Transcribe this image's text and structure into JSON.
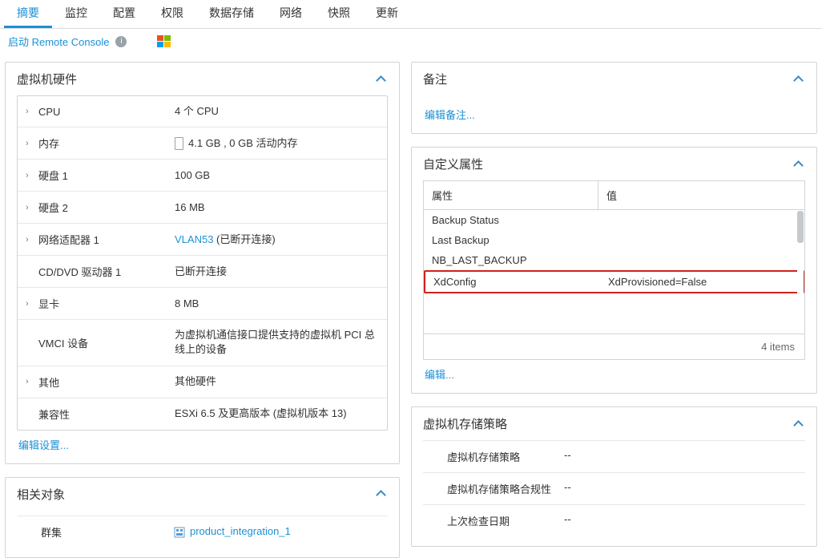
{
  "tabs": [
    "摘要",
    "监控",
    "配置",
    "权限",
    "数据存储",
    "网络",
    "快照",
    "更新"
  ],
  "console_link": "启动 Remote Console",
  "hw": {
    "title": "虚拟机硬件",
    "edit_link": "编辑设置...",
    "rows": {
      "cpu_k": "CPU",
      "cpu_v": "4 个 CPU",
      "mem_k": "内存",
      "mem_v": "4.1 GB , 0 GB 活动内存",
      "d1_k": "硬盘 1",
      "d1_v": "100 GB",
      "d2_k": "硬盘 2",
      "d2_v": "16 MB",
      "net_k": "网络适配器 1",
      "net_v_link": "VLAN53",
      "net_v_suffix": " (已断开连接)",
      "cd_k": "CD/DVD 驱动器 1",
      "cd_v": "已断开连接",
      "vid_k": "显卡",
      "vid_v": "8 MB",
      "vmci_k": "VMCI 设备",
      "vmci_v": "为虚拟机通信接口提供支持的虚拟机 PCI 总线上的设备",
      "oth_k": "其他",
      "oth_v": "其他硬件",
      "comp_k": "兼容性",
      "comp_v": "ESXi 6.5 及更高版本 (虚拟机版本 13)"
    }
  },
  "related": {
    "title": "相关对象",
    "cluster_k": "群集",
    "cluster_v": "product_integration_1"
  },
  "notes": {
    "title": "备注",
    "edit_link": "编辑备注..."
  },
  "custom": {
    "title": "自定义属性",
    "col_attr": "属性",
    "col_val": "值",
    "rows": [
      {
        "a": "Backup Status",
        "v": ""
      },
      {
        "a": "Last Backup",
        "v": ""
      },
      {
        "a": "NB_LAST_BACKUP",
        "v": ""
      },
      {
        "a": "XdConfig",
        "v": "XdProvisioned=False"
      }
    ],
    "footer_count": "4 items",
    "edit_link": "编辑..."
  },
  "storage": {
    "title": "虚拟机存储策略",
    "rows": {
      "pol_k": "虚拟机存储策略",
      "pol_v": "--",
      "cmp_k": "虚拟机存储策略合规性",
      "cmp_v": "--",
      "chk_k": "上次检查日期",
      "chk_v": "--"
    }
  }
}
